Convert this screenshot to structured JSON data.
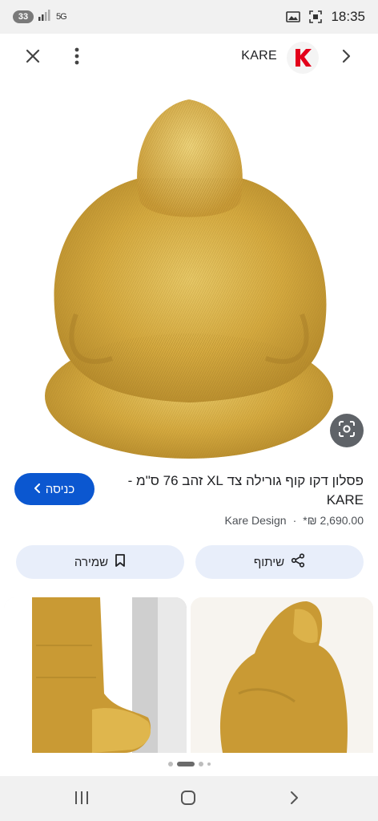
{
  "status_bar": {
    "badge": "33",
    "network": "5G",
    "time": "18:35"
  },
  "top_bar": {
    "site_name": "KARE",
    "logo_letter": "K",
    "logo_color": "#e3001b"
  },
  "product": {
    "title": "פסלון דקו קוף גורילה צד XL זהב 76 ס\"מ - KARE",
    "price": "2,690.00 ₪*",
    "seller": "Kare Design",
    "separator": "·"
  },
  "buttons": {
    "visit_label": "כניסה",
    "share_label": "שיתוף",
    "save_label": "שמירה"
  },
  "carousel": {
    "pages": 4,
    "active_index": 1
  },
  "colors": {
    "accent": "#0b57d0",
    "chip_bg": "#e8eefa",
    "gold": "#d9b24a"
  }
}
